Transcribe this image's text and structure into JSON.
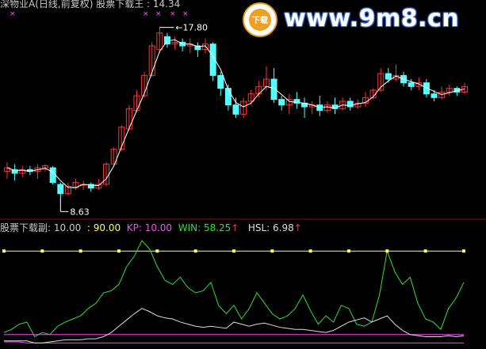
{
  "header": {
    "title": "深物业A(日线,前复权) 股票下载王 : 14.34",
    "high_label": "17.80",
    "low_label": "8.63"
  },
  "watermark": {
    "text": "www.9m8.cn",
    "badge_char": "下载"
  },
  "indicator_bar": {
    "name": "股票下载副",
    "v1": ": 10.00",
    "v2": ": 90.00",
    "kp_label": "KP: 10.00",
    "win_label": "WIN: 58.25",
    "hsl_label": "HSL: 6.98",
    "arrow": "↑"
  },
  "colors": {
    "background": "#000000",
    "up_candle": "#ff3333",
    "down_candle": "#54ffff",
    "ma_line": "#ffffff",
    "yellow_line": "#ffff66",
    "green_line": "#33dd33",
    "white_line": "#dddddd",
    "magenta_line": "#ff44ff",
    "marker": "#ff55ff",
    "grid_divider": "#7a1010",
    "text_gray": "#c8c8c8",
    "text_kp": "#ff44ff",
    "text_win": "#33dd33",
    "text_hsl": "#dddddd",
    "arrow_red": "#ff3333"
  },
  "chart_data": [
    {
      "type": "candlestick",
      "title": "深物业A(日线,前复权)",
      "annotations": [
        {
          "label": "17.80",
          "kind": "high"
        },
        {
          "label": "8.63",
          "kind": "low"
        }
      ],
      "ylim": [
        7.8,
        18.6
      ],
      "candles": [
        [
          10.0,
          10.2,
          9.6,
          10.5
        ],
        [
          10.1,
          9.9,
          9.5,
          10.4
        ],
        [
          9.9,
          10.1,
          9.7,
          10.3
        ],
        [
          10.1,
          10.0,
          9.8,
          10.3
        ],
        [
          10.0,
          10.2,
          9.6,
          10.4
        ],
        [
          10.2,
          10.3,
          10.0,
          10.4
        ],
        [
          10.2,
          9.4,
          9.3,
          10.3
        ],
        [
          9.3,
          8.8,
          8.6,
          9.4
        ],
        [
          8.8,
          9.2,
          8.7,
          9.4
        ],
        [
          9.1,
          9.4,
          9.0,
          9.6
        ],
        [
          9.3,
          9.3,
          9.0,
          9.5
        ],
        [
          9.3,
          9.1,
          8.9,
          9.4
        ],
        [
          9.1,
          9.3,
          9.0,
          9.6
        ],
        [
          9.3,
          10.4,
          9.2,
          10.5
        ],
        [
          10.4,
          11.2,
          10.3,
          11.3
        ],
        [
          11.2,
          12.4,
          11.1,
          12.5
        ],
        [
          12.3,
          13.4,
          12.2,
          13.6
        ],
        [
          13.3,
          14.1,
          13.2,
          14.4
        ],
        [
          14.1,
          15.2,
          14.0,
          15.4
        ],
        [
          15.2,
          16.8,
          15.1,
          17.0
        ],
        [
          16.6,
          17.5,
          16.4,
          17.8
        ],
        [
          17.3,
          16.9,
          16.7,
          17.5
        ],
        [
          16.9,
          17.0,
          16.6,
          17.3
        ],
        [
          17.0,
          16.8,
          16.5,
          17.2
        ],
        [
          16.8,
          16.9,
          16.4,
          17.2
        ],
        [
          16.8,
          16.6,
          16.2,
          17.0
        ],
        [
          16.6,
          16.9,
          16.4,
          17.2
        ],
        [
          16.9,
          15.2,
          14.9,
          17.0
        ],
        [
          15.2,
          14.5,
          14.1,
          15.4
        ],
        [
          14.5,
          13.6,
          13.3,
          14.7
        ],
        [
          13.6,
          13.1,
          12.9,
          14.0
        ],
        [
          13.1,
          13.8,
          12.9,
          14.0
        ],
        [
          13.8,
          14.2,
          13.6,
          14.4
        ],
        [
          14.2,
          14.6,
          14.0,
          14.9
        ],
        [
          14.6,
          15.0,
          14.4,
          15.7
        ],
        [
          15.0,
          13.9,
          13.7,
          15.6
        ],
        [
          13.9,
          13.6,
          13.3,
          14.1
        ],
        [
          13.6,
          13.9,
          13.1,
          14.2
        ],
        [
          13.9,
          13.7,
          13.4,
          14.3
        ],
        [
          13.7,
          13.5,
          12.9,
          14.0
        ],
        [
          13.5,
          13.6,
          13.1,
          13.8
        ],
        [
          13.6,
          13.3,
          13.0,
          14.1
        ],
        [
          13.3,
          13.6,
          13.2,
          13.8
        ],
        [
          13.6,
          13.4,
          13.1,
          14.0
        ],
        [
          13.4,
          13.8,
          13.3,
          14.0
        ],
        [
          13.8,
          13.5,
          13.3,
          14.0
        ],
        [
          13.5,
          13.7,
          13.4,
          13.9
        ],
        [
          13.7,
          14.0,
          13.5,
          14.3
        ],
        [
          14.0,
          14.4,
          13.9,
          14.5
        ],
        [
          14.4,
          15.3,
          14.3,
          15.6
        ],
        [
          15.3,
          15.0,
          14.8,
          15.6
        ],
        [
          15.0,
          15.2,
          14.9,
          15.8
        ],
        [
          15.2,
          14.8,
          14.6,
          15.4
        ],
        [
          14.8,
          14.6,
          14.4,
          15.0
        ],
        [
          14.6,
          14.8,
          14.4,
          15.1
        ],
        [
          14.8,
          14.2,
          14.0,
          15.0
        ],
        [
          14.2,
          14.0,
          13.8,
          14.4
        ],
        [
          14.0,
          14.3,
          13.9,
          14.6
        ],
        [
          14.3,
          14.5,
          14.1,
          14.7
        ],
        [
          14.5,
          14.3,
          14.1,
          14.6
        ],
        [
          14.3,
          14.6,
          14.2,
          14.8
        ]
      ]
    },
    {
      "type": "line",
      "ylim": [
        0,
        100
      ],
      "series": [
        {
          "values": [
            10,
            10,
            10,
            10,
            10,
            10,
            10,
            10,
            10,
            10,
            10,
            10,
            10,
            10,
            10,
            10,
            10,
            10,
            10,
            10,
            10,
            10,
            10,
            10,
            10,
            10,
            10,
            10,
            10,
            10,
            10,
            10,
            10,
            10,
            10,
            10,
            10,
            10,
            10,
            10,
            10,
            10,
            10,
            10,
            10,
            10,
            10,
            10,
            10,
            10,
            10,
            10,
            10,
            10,
            10,
            10,
            10,
            10,
            10,
            10,
            10
          ]
        },
        {
          "values": [
            90,
            90,
            90,
            90,
            90,
            90,
            90,
            90,
            90,
            90,
            90,
            90,
            90,
            90,
            90,
            90,
            90,
            90,
            90,
            90,
            90,
            90,
            90,
            90,
            90,
            90,
            90,
            90,
            90,
            90,
            90,
            90,
            90,
            90,
            90,
            90,
            90,
            90,
            90,
            90,
            90,
            90,
            90,
            90,
            90,
            90,
            90,
            90,
            90,
            90,
            90,
            90,
            90,
            90,
            90,
            90,
            90,
            90,
            90,
            90,
            90
          ]
        },
        {
          "values": [
            3,
            3,
            3,
            2,
            2,
            2,
            2,
            2,
            2,
            2,
            2,
            2,
            2,
            2,
            2,
            2,
            2,
            2,
            2,
            2,
            2,
            2,
            2,
            2,
            2,
            2,
            2,
            2,
            2,
            2,
            2,
            2,
            2,
            2,
            2,
            2,
            2,
            2,
            2,
            2,
            2,
            2,
            2,
            2,
            2,
            2,
            2,
            2,
            2,
            2,
            2,
            2,
            2,
            2,
            2,
            2,
            2,
            2,
            2,
            2,
            2
          ]
        },
        {
          "values": [
            12,
            15,
            20,
            22,
            8,
            12,
            10,
            18,
            22,
            25,
            28,
            35,
            40,
            50,
            52,
            58,
            75,
            85,
            100,
            92,
            75,
            62,
            58,
            65,
            55,
            50,
            52,
            60,
            38,
            30,
            38,
            25,
            35,
            50,
            40,
            30,
            25,
            28,
            35,
            48,
            33,
            20,
            28,
            22,
            38,
            35,
            20,
            18,
            22,
            48,
            90,
            70,
            58,
            65,
            40,
            25,
            22,
            15,
            35,
            45,
            60
          ]
        },
        {
          "values": [
            4,
            4,
            4,
            4,
            2,
            2,
            3,
            4,
            5,
            5,
            5,
            6,
            6,
            8,
            12,
            18,
            24,
            30,
            35,
            32,
            28,
            26,
            25,
            22,
            20,
            18,
            17,
            18,
            17,
            16,
            22,
            20,
            18,
            20,
            21,
            19,
            17,
            16,
            15,
            15,
            14,
            13,
            12,
            14,
            18,
            22,
            24,
            26,
            22,
            25,
            28,
            20,
            14,
            10,
            9,
            8,
            8,
            8,
            9,
            8,
            9
          ]
        }
      ]
    }
  ]
}
